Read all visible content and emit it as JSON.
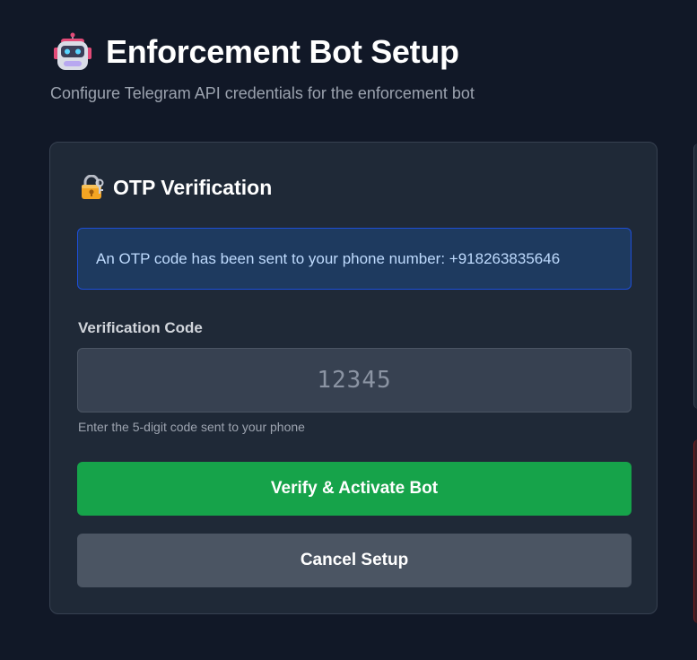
{
  "header": {
    "icon": "robot-icon",
    "title": "Enforcement Bot Setup",
    "subtitle": "Configure Telegram API credentials for the enforcement bot"
  },
  "otp_card": {
    "icon": "lock-icon",
    "title": "OTP Verification",
    "info_message": "An OTP code has been sent to your phone number: +918263835646",
    "code_field": {
      "label": "Verification Code",
      "placeholder": "12345",
      "value": "",
      "helper_text": "Enter the 5-digit code sent to your phone"
    },
    "verify_button_label": "Verify & Activate Bot",
    "cancel_button_label": "Cancel Setup"
  },
  "colors": {
    "background": "#111827",
    "card_background": "#1f2937",
    "info_background": "#1e3a5f",
    "info_border": "#1d4ed8",
    "info_text": "#bfdbfe",
    "verify_button": "#16a34a",
    "cancel_button": "#4b5563",
    "input_background": "#374151"
  }
}
